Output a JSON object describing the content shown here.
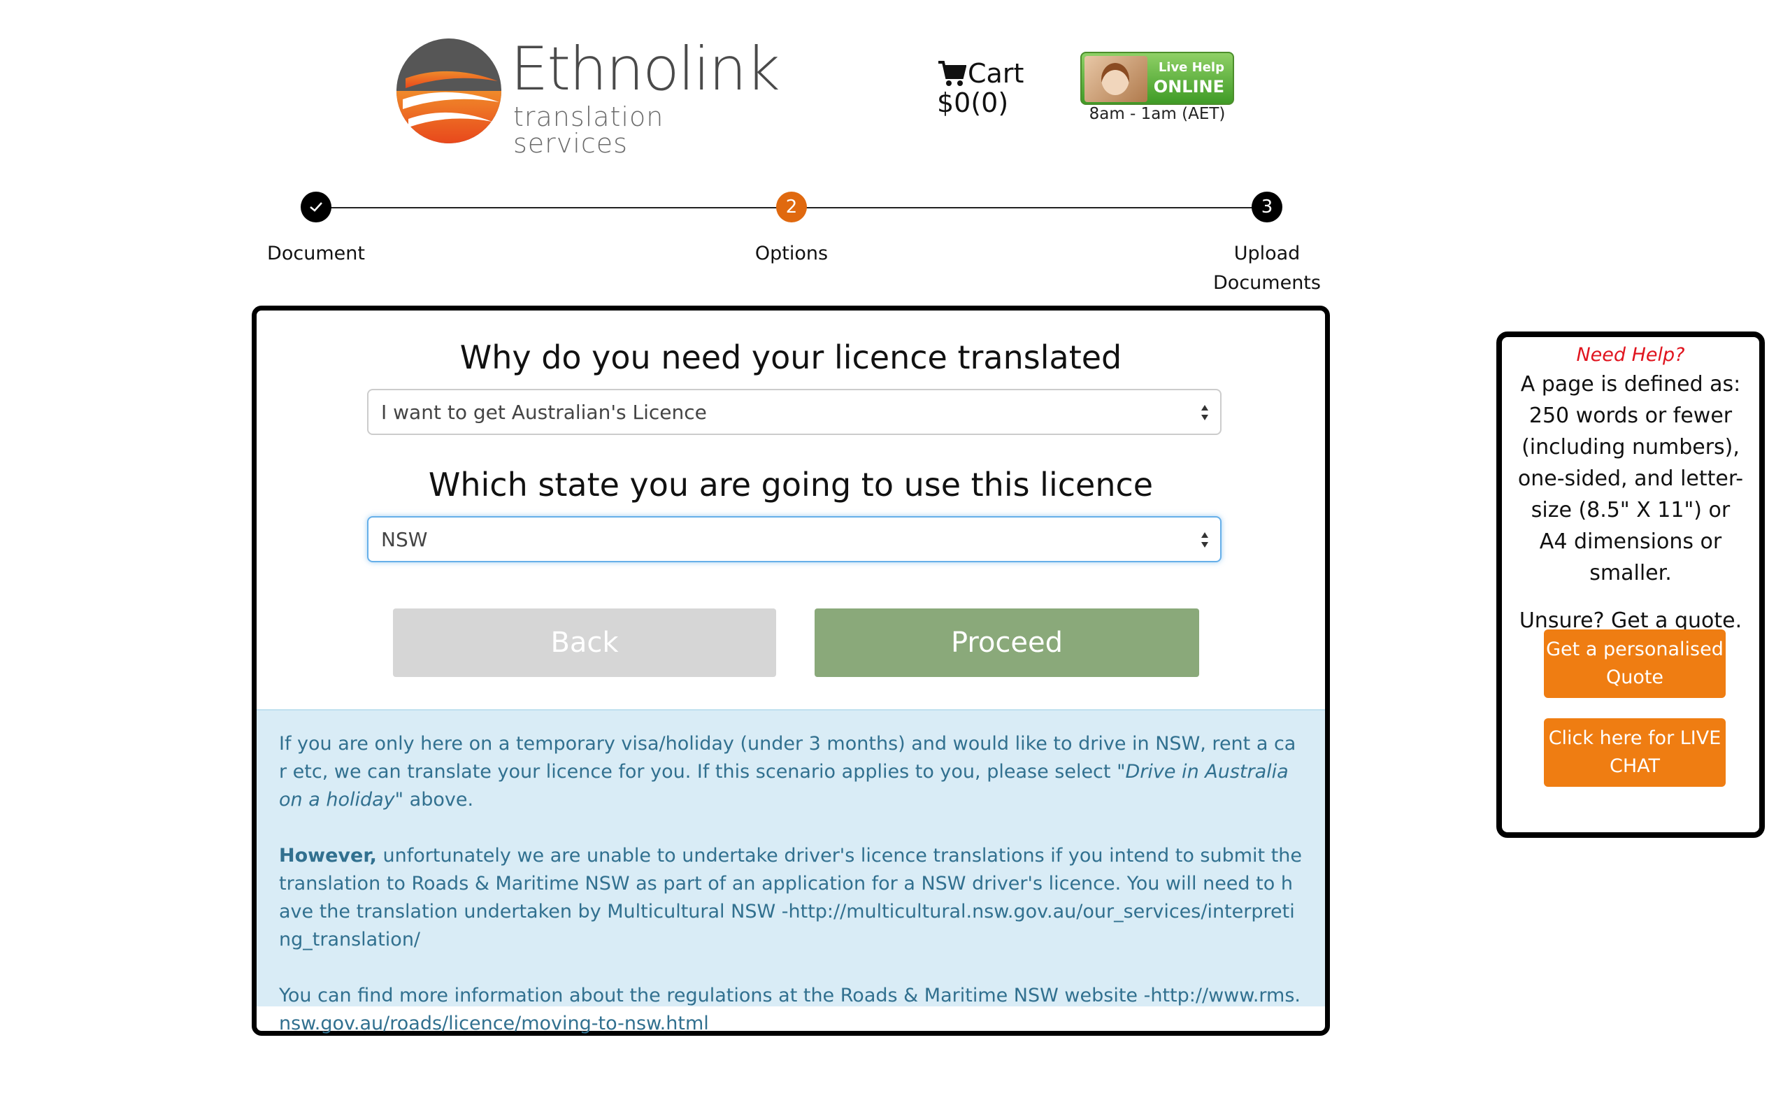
{
  "header": {
    "logo_word": "Ethnolink",
    "logo_sub": "translation services",
    "cart_label": "Cart",
    "cart_total": "$0(0)",
    "livehelp_line1": "Live Help",
    "livehelp_line2": "ONLINE",
    "hours": "8am - 1am (AET)"
  },
  "steps": [
    {
      "label": "Document",
      "state": "done"
    },
    {
      "label": "Options",
      "number": "2",
      "state": "active"
    },
    {
      "label_line1": "Upload",
      "label_line2": "Documents",
      "number": "3",
      "state": "pending"
    }
  ],
  "form": {
    "q1": "Why do you need your licence translated",
    "reason_value": "I want to get Australian's Licence",
    "q2": "Which state you are going to use this licence",
    "state_value": "NSW",
    "back_label": "Back",
    "proceed_label": "Proceed"
  },
  "info": {
    "p1_a": "If you are only here on a temporary visa/holiday (under 3 months) and would like to drive in NSW, rent a car etc, we can translate your licence for you. If this scenario applies to you, please select ",
    "p1_em": "\"Drive in Australia on a holiday\"",
    "p1_b": " above.",
    "p2_strong": "However,",
    "p2_text": " unfortunately we are unable to undertake driver's licence translations if you intend to submit the translation to Roads & Maritime NSW as part of an application for a NSW driver's licence. You will need to have the translation undertaken by Multicultural NSW -",
    "p2_link": "http://multicultural.nsw.gov.au/our_services/interpreting_translation/",
    "p3_text": "You can find more information about the regulations at the Roads & Maritime NSW website -",
    "p3_link": "http://www.rms.nsw.gov.au/roads/licence/moving-to-nsw.html"
  },
  "help": {
    "title": "Need Help?",
    "definition": "A page is defined as: 250 words or fewer (including numbers), one-sided, and letter-size (8.5\" X 11\") or A4 dimensions or smaller.",
    "unsure": "Unsure? Get a quote.",
    "quote_btn": "Get a personalised Quote",
    "chat_btn": "Click here for LIVE CHAT"
  },
  "colors": {
    "accent_orange": "#ef7d12",
    "step_active": "#e0690f",
    "proceed_green": "#8aa97a",
    "back_gray": "#d6d6d6",
    "info_bg": "#d9ecf6",
    "info_text": "#31708f",
    "need_help_red": "#e0141e"
  }
}
